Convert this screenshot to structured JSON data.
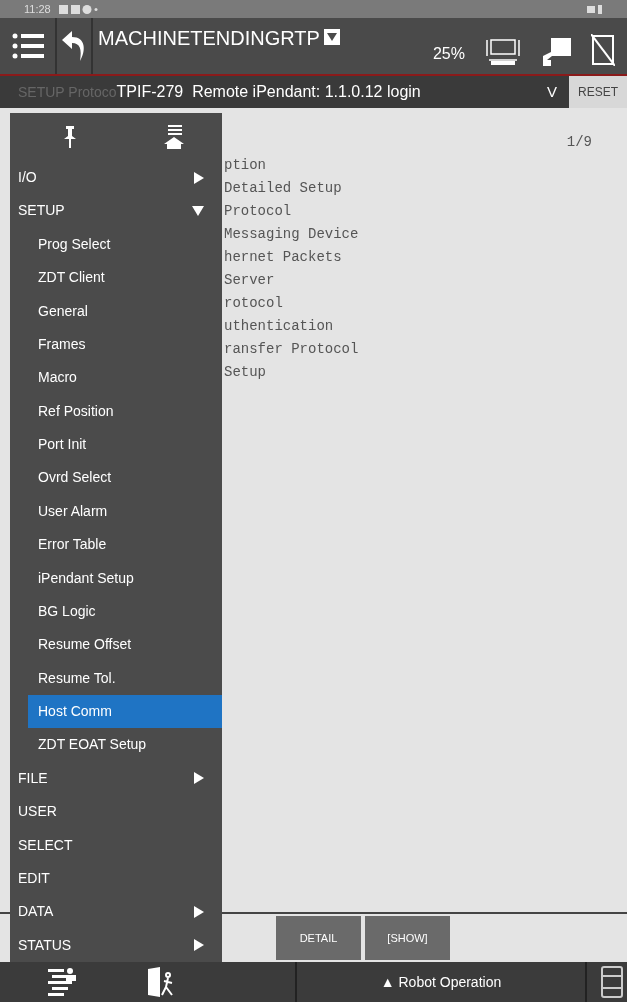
{
  "status_bar": {
    "time": "11:28"
  },
  "header": {
    "program": "MACHINETENDINGRTP",
    "override": "25%"
  },
  "message_bar": {
    "screen_title": "SETUP Protoco",
    "message": "TPIF-279  Remote iPendant: 1.1.0.12 login",
    "expand": "V",
    "reset": "RESET"
  },
  "listing": {
    "page": "1/9",
    "lines": [
      "ption",
      "Detailed Setup",
      "Protocol",
      "Messaging Device",
      "hernet Packets",
      "Server",
      "rotocol",
      "uthentication",
      "ransfer Protocol",
      "Setup"
    ]
  },
  "menu": {
    "items": [
      {
        "label": "I/O",
        "kind": "folder",
        "expanded": false,
        "selected": false
      },
      {
        "label": "SETUP",
        "kind": "folder",
        "expanded": true,
        "selected": false
      },
      {
        "label": "Prog Select",
        "kind": "sub",
        "selected": false
      },
      {
        "label": "ZDT Client",
        "kind": "sub",
        "selected": false
      },
      {
        "label": "General",
        "kind": "sub",
        "selected": false
      },
      {
        "label": "Frames",
        "kind": "sub",
        "selected": false
      },
      {
        "label": "Macro",
        "kind": "sub",
        "selected": false
      },
      {
        "label": "Ref Position",
        "kind": "sub",
        "selected": false
      },
      {
        "label": "Port Init",
        "kind": "sub",
        "selected": false
      },
      {
        "label": "Ovrd Select",
        "kind": "sub",
        "selected": false
      },
      {
        "label": "User Alarm",
        "kind": "sub",
        "selected": false
      },
      {
        "label": "Error Table",
        "kind": "sub",
        "selected": false
      },
      {
        "label": "iPendant Setup",
        "kind": "sub",
        "selected": false
      },
      {
        "label": "BG Logic",
        "kind": "sub",
        "selected": false
      },
      {
        "label": "Resume Offset",
        "kind": "sub",
        "selected": false
      },
      {
        "label": "Resume Tol.",
        "kind": "sub",
        "selected": false
      },
      {
        "label": "Host Comm",
        "kind": "sub",
        "selected": true
      },
      {
        "label": "ZDT EOAT Setup",
        "kind": "sub",
        "selected": false
      },
      {
        "label": "FILE",
        "kind": "folder",
        "expanded": false,
        "selected": false
      },
      {
        "label": "USER",
        "kind": "top",
        "selected": false
      },
      {
        "label": "SELECT",
        "kind": "top",
        "selected": false
      },
      {
        "label": "EDIT",
        "kind": "top",
        "selected": false
      },
      {
        "label": "DATA",
        "kind": "folder",
        "expanded": false,
        "selected": false
      },
      {
        "label": "STATUS",
        "kind": "folder",
        "expanded": false,
        "selected": false
      }
    ]
  },
  "function_keys": [
    "DETAIL",
    "[SHOW]"
  ],
  "bottom_bar": {
    "robot_operation": "▲ Robot Operation"
  }
}
